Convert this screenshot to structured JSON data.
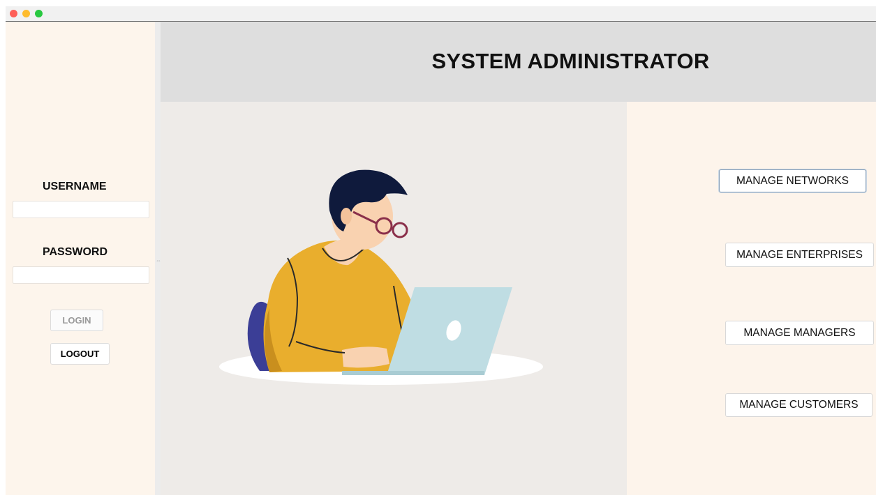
{
  "header": {
    "title": "SYSTEM ADMINISTRATOR"
  },
  "login": {
    "username_label": "USERNAME",
    "username_value": "",
    "password_label": "PASSWORD",
    "password_value": "",
    "login_label": "LOGIN",
    "logout_label": "LOGOUT"
  },
  "menu": {
    "networks": "MANAGE NETWORKS",
    "enterprises": "MANAGE ENTERPRISES",
    "managers": "MANAGE MANAGERS",
    "customers": "MANAGE CUSTOMERS"
  },
  "colors": {
    "side_panel": "#fdf5ec",
    "header": "#dedede",
    "center_panel": "#eeebe8",
    "sweater": "#e8ad2c",
    "laptop": "#bfdde3",
    "hair": "#0f1a3c"
  }
}
